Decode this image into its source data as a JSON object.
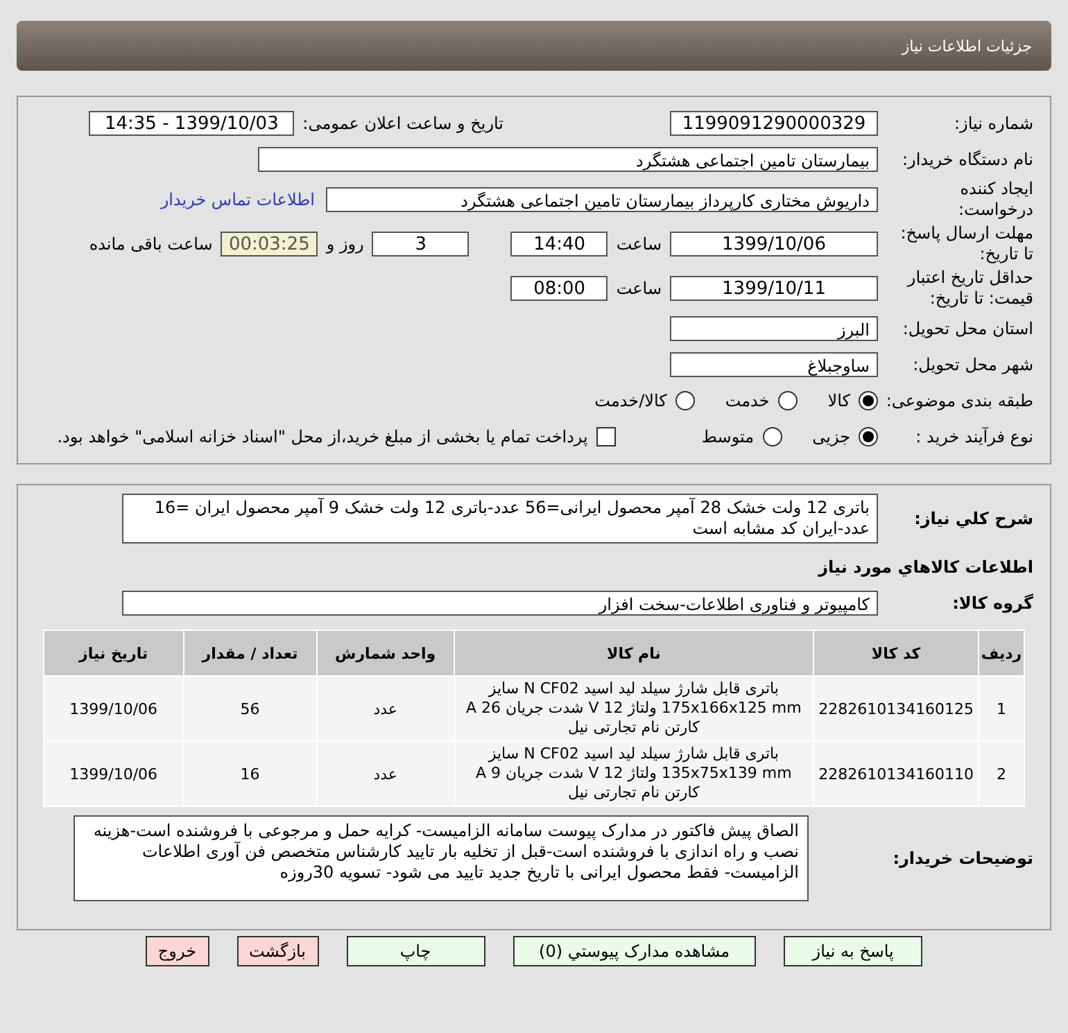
{
  "header": {
    "title": "جزئیات اطلاعات نیاز"
  },
  "need_number": {
    "label": "شماره نیاز:",
    "value": "1199091290000329"
  },
  "announce_date": {
    "label": "تاریخ و ساعت اعلان عمومی:",
    "value": "1399/10/03 - 14:35"
  },
  "buyer": {
    "label": "نام دستگاه خریدار:",
    "value": "بیمارستان تامین اجتماعی هشتگرد"
  },
  "requester": {
    "label": "ایجاد کننده\nدرخواست:",
    "value": "داریوش مختاری کارپرداز بیمارستان تامین اجتماعی هشتگرد",
    "link": "اطلاعات تماس خریدار"
  },
  "deadline": {
    "label": "مهلت ارسال پاسخ:\nتا تاریخ:",
    "date": "1399/10/06",
    "time_label": "ساعت",
    "time": "14:40",
    "days": "3",
    "days_label": "روز و",
    "remaining": "00:03:25",
    "remaining_label": "ساعت باقی مانده"
  },
  "validity": {
    "label": "حداقل تاریخ اعتبار\nقیمت: تا تاریخ:",
    "date": "1399/10/11",
    "time_label": "ساعت",
    "time": "08:00"
  },
  "province": {
    "label": "استان محل تحویل:",
    "value": "البرز"
  },
  "city": {
    "label": "شهر محل تحویل:",
    "value": "ساوجبلاغ"
  },
  "category": {
    "label": "طبقه بندی موضوعی:",
    "options": [
      {
        "label": "کالا",
        "selected": true
      },
      {
        "label": "خدمت",
        "selected": false
      },
      {
        "label": "کالا/خدمت",
        "selected": false
      }
    ]
  },
  "process": {
    "label": "نوع فرآیند خرید :",
    "options": [
      {
        "label": "جزیی",
        "selected": true
      },
      {
        "label": "متوسط",
        "selected": false
      }
    ],
    "payment": {
      "label": "پرداخت تمام یا بخشی از مبلغ خرید،از محل \"اسناد خزانه اسلامی\" خواهد بود.",
      "checked": false
    }
  },
  "description": {
    "label": "شرح کلي نياز:",
    "value": "باتری 12 ولت خشک 28 آمپر محصول ایرانی=56 عدد-باتری 12 ولت خشک 9 آمپر محصول ایران =16 عدد-ایران کد مشابه است"
  },
  "goods_title": "اطلاعات كالاهاي مورد نياز",
  "goods_group": {
    "label": "گروه كالا:",
    "value": "کامپیوتر و فناوری اطلاعات-سخت افزار"
  },
  "table": {
    "columns": [
      "ردیف",
      "کد کالا",
      "نام کالا",
      "واحد شمارش",
      "تعداد / مقدار",
      "تاریخ نیاز"
    ],
    "rows": [
      [
        "1",
        "2282610134160125",
        "باتری قابل شارژ سیلد لید اسید N CF02 سایز 175x166x125 mm ولتاژ 12 V شدت جریان 26 A کارتن نام تجارتی نیل",
        "عدد",
        "56",
        "1399/10/06"
      ],
      [
        "2",
        "2282610134160110",
        "باتری قابل شارژ سیلد لید اسید N CF02 سایز 135x75x139 mm ولتاژ 12 V شدت جریان 9 A کارتن نام تجارتی نیل",
        "عدد",
        "16",
        "1399/10/06"
      ]
    ]
  },
  "buyer_notes": {
    "label": "توضیحات خریدار:",
    "value": "الصاق پیش فاکتور در مدارک پیوست سامانه الزامیست- کرایه حمل و مرجوعی با فروشنده است-هزینه نصب و راه اندازی با فروشنده است-قبل از تخلیه بار تایید کارشناس متخصص فن آوری اطلاعات الزامیست- فقط محصول ایرانی با تاریخ جدید تایید می شود- تسویه 30روزه"
  },
  "buttons": [
    {
      "label": "پاسخ به نیاز",
      "kind": "go"
    },
    {
      "label": "مشاهده مدارک پیوستي (0)",
      "kind": "go"
    },
    {
      "label": "چاپ",
      "kind": "go"
    },
    {
      "label": "بازگشت",
      "kind": "stop"
    },
    {
      "label": "خروج",
      "kind": "stop"
    }
  ]
}
